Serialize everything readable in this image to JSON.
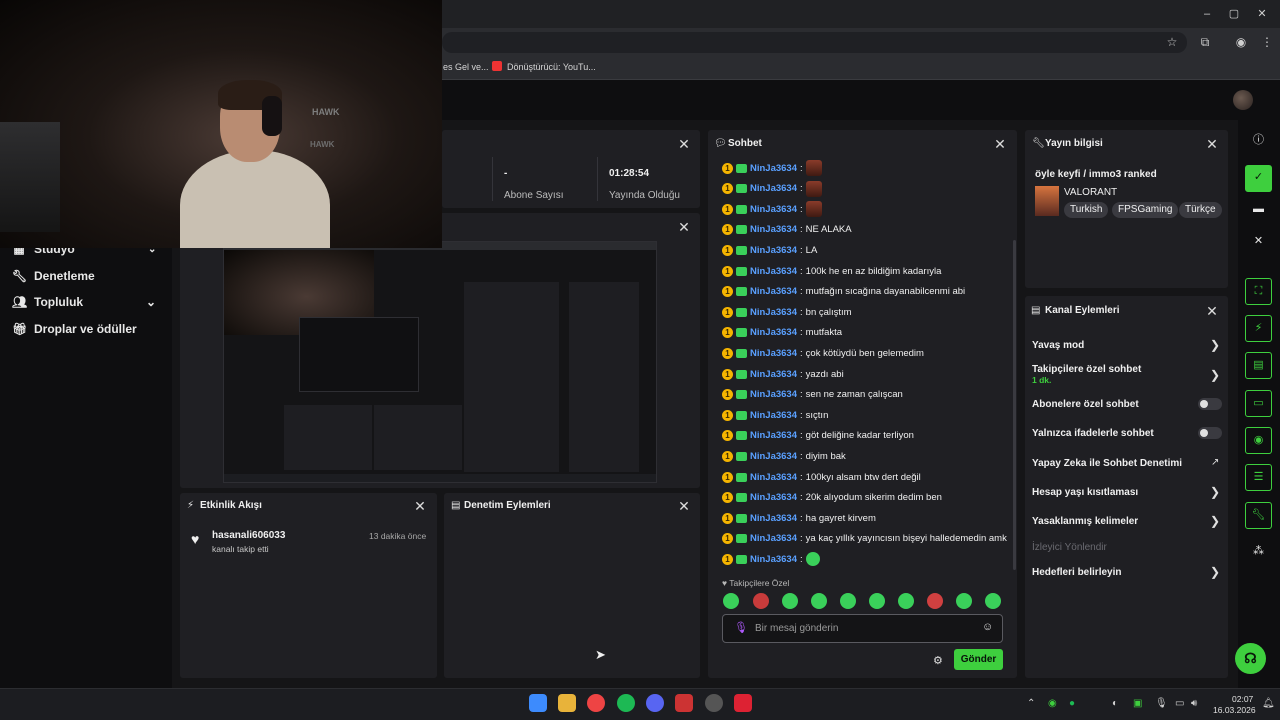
{
  "browser": {
    "bookmarks": [
      "es Gel ve...",
      "Dönüştürücü: YouTu..."
    ],
    "window_controls": {
      "minimize": "–",
      "maximize": "▢",
      "close": "✕"
    }
  },
  "webcam": {
    "logo_top": "HAWK",
    "logo_bottom": "HAWK"
  },
  "nav": {
    "items": [
      {
        "label": "Stüdyo",
        "icon": "studio-icon"
      },
      {
        "label": "Denetleme",
        "icon": "wrench-icon"
      },
      {
        "label": "Topluluk",
        "icon": "people-icon"
      },
      {
        "label": "Droplar ve ödüller",
        "icon": "gift-icon"
      }
    ]
  },
  "stats": {
    "subs_value": "-",
    "subs_label": "Abone Sayısı",
    "live_value": "01:28:54",
    "live_label": "Yayında Olduğu"
  },
  "activity": {
    "title": "Etkinlik Akışı",
    "event_user": "hasanali606033",
    "event_time": "13 dakika önce",
    "event_text": "kanalı takip etti"
  },
  "moderation": {
    "title": "Denetim Eylemleri"
  },
  "chat": {
    "title": "Sohbet",
    "username": "NinJa3634",
    "messages": [
      {
        "type": "emote",
        "text": ""
      },
      {
        "type": "emote",
        "text": ""
      },
      {
        "type": "emote",
        "text": ""
      },
      {
        "type": "text",
        "text": "NE ALAKA"
      },
      {
        "type": "text",
        "text": "LA"
      },
      {
        "type": "text",
        "text": "100k he en az bildiğim kadarıyla"
      },
      {
        "type": "text",
        "text": "mutfağın sıcağına dayanabilcenmi abi"
      },
      {
        "type": "text",
        "text": "bn çalıştım"
      },
      {
        "type": "text",
        "text": "mutfakta"
      },
      {
        "type": "text",
        "text": "çok kötüydü ben gelemedim"
      },
      {
        "type": "text",
        "text": "yazdı abi"
      },
      {
        "type": "text",
        "text": "sen ne zaman çalışcan"
      },
      {
        "type": "text",
        "text": "sıçtın"
      },
      {
        "type": "text",
        "text": "göt deliğine kadar terliyon"
      },
      {
        "type": "text",
        "text": "diyim bak"
      },
      {
        "type": "text",
        "text": "100kyı alsam btw dert değil"
      },
      {
        "type": "text",
        "text": "20k alıyodum sikerim dedim ben"
      },
      {
        "type": "text",
        "text": "ha gayret kirvem"
      },
      {
        "type": "text",
        "text": "ya kaç yıllık yayıncısın bişeyi halledemedin amk"
      },
      {
        "type": "green-emote",
        "text": ""
      }
    ],
    "followers_only_label": "Takipçilere Özel",
    "input_placeholder": "Bir mesaj gönderin",
    "send_label": "Gönder"
  },
  "stream_info": {
    "title_label": "Yayın bilgisi",
    "stream_title": "öyle keyfi / immo3 ranked",
    "game": "VALORANT",
    "tags": [
      "Turkish",
      "FPSGaming",
      "Türkçe"
    ]
  },
  "channel_actions": {
    "title": "Kanal Eylemleri",
    "items": [
      {
        "label": "Yavaş mod",
        "control": "chevron"
      },
      {
        "label": "Takipçilere özel sohbet",
        "sub": "1 dk.",
        "control": "chevron"
      },
      {
        "label": "Abonelere özel sohbet",
        "control": "toggle"
      },
      {
        "label": "Yalnızca ifadelerle sohbet",
        "control": "toggle"
      },
      {
        "label": "Yapay Zeka ile Sohbet Denetimi",
        "control": "external"
      },
      {
        "label": "Hesap yaşı kısıtlaması",
        "control": "chevron"
      },
      {
        "label": "Yasaklanmış kelimeler",
        "control": "chevron"
      },
      {
        "label": "İzleyici Yönlendir",
        "control": "none",
        "disabled": true
      },
      {
        "label": "Hedefleri belirleyin",
        "control": "chevron"
      }
    ]
  },
  "taskbar": {
    "time": "02:07",
    "date": "16.03.2026"
  },
  "colors": {
    "accent": "#3ecf3e",
    "username": "#5aa0ff",
    "panel": "#1f1f23",
    "background": "#151517"
  }
}
